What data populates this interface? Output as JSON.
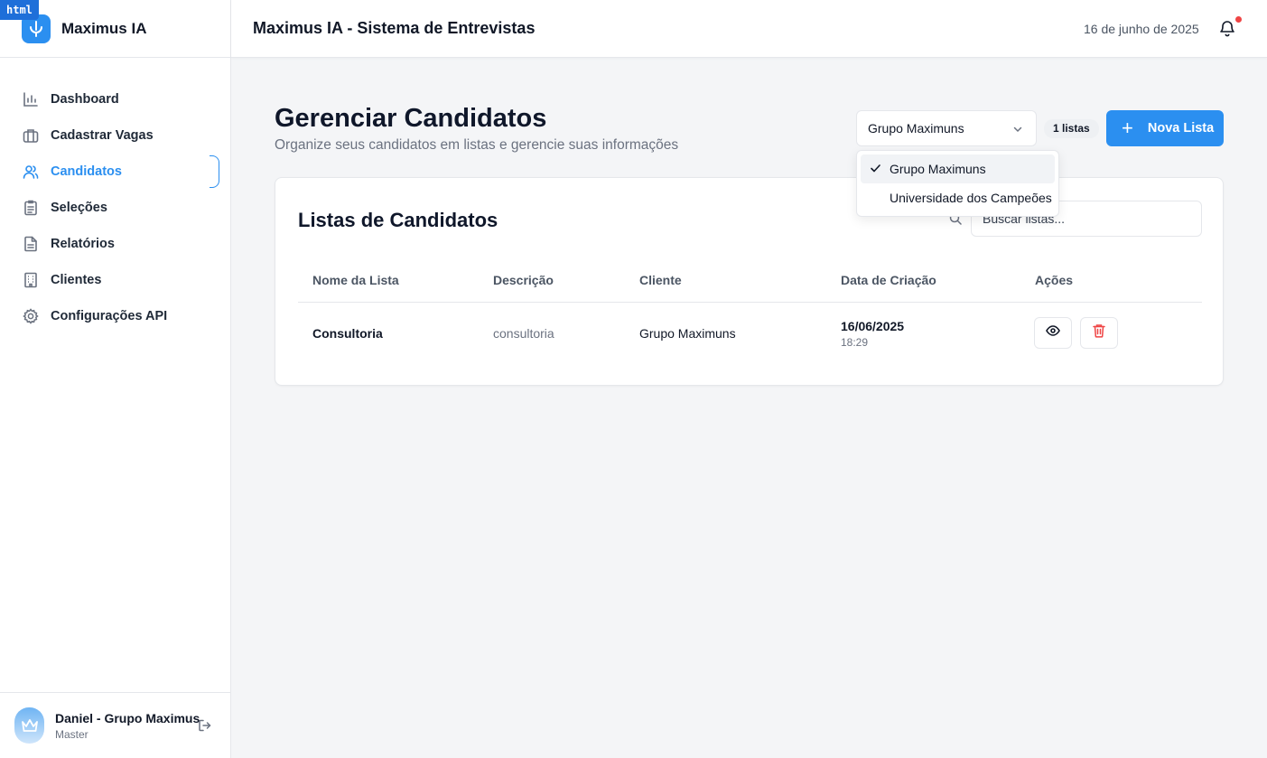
{
  "badge_tag": "html",
  "brand": {
    "name": "Maximus IA"
  },
  "sidebar": {
    "items": [
      {
        "label": "Dashboard",
        "icon": "bar-chart-icon",
        "active": false
      },
      {
        "label": "Cadastrar Vagas",
        "icon": "briefcase-icon",
        "active": false
      },
      {
        "label": "Candidatos",
        "icon": "users-icon",
        "active": true
      },
      {
        "label": "Seleções",
        "icon": "clipboard-list-icon",
        "active": false
      },
      {
        "label": "Relatórios",
        "icon": "file-text-icon",
        "active": false
      },
      {
        "label": "Clientes",
        "icon": "building-icon",
        "active": false
      },
      {
        "label": "Configurações API",
        "icon": "gear-icon",
        "active": false
      }
    ]
  },
  "user": {
    "name": "Daniel - Grupo Maximus",
    "role": "Master"
  },
  "topbar": {
    "title": "Maximus IA - Sistema de Entrevistas",
    "date": "16 de junho de 2025"
  },
  "page": {
    "title": "Gerenciar Candidatos",
    "subtitle": "Organize seus candidatos em listas e gerencie suas informações"
  },
  "client_select": {
    "value": "Grupo Maximuns",
    "options": [
      "Grupo Maximuns",
      "Universidade dos Campeões"
    ],
    "selected_index": 0
  },
  "count_badge": "1 listas",
  "new_list_button": {
    "label": "Nova Lista"
  },
  "lists_card": {
    "title": "Listas de Candidatos",
    "search_placeholder": "Buscar listas...",
    "columns": [
      "Nome da Lista",
      "Descrição",
      "Cliente",
      "Data de Criação",
      "Ações"
    ],
    "rows": [
      {
        "name": "Consultoria",
        "description": "consultoria",
        "client": "Grupo Maximuns",
        "date": "16/06/2025",
        "time": "18:29"
      }
    ]
  },
  "colors": {
    "accent": "#2b8ff0",
    "danger": "#ef4444",
    "background": "#f4f5f7"
  }
}
